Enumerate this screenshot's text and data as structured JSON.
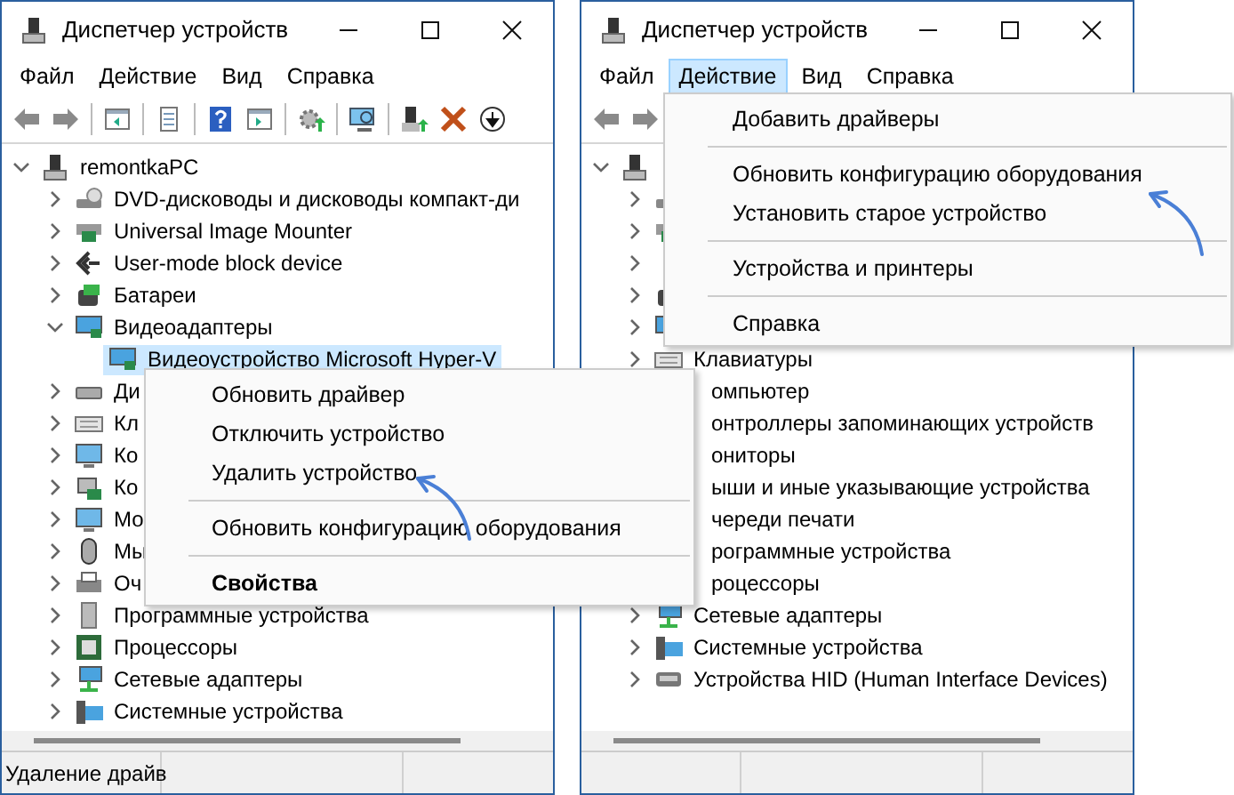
{
  "windows": [
    {
      "title": "Диспетчер устройств",
      "menu": [
        {
          "label": "Файл",
          "selected": false
        },
        {
          "label": "Действие",
          "selected": false
        },
        {
          "label": "Вид",
          "selected": false
        },
        {
          "label": "Справка",
          "selected": false
        }
      ],
      "toolbar": [
        {
          "kind": "back"
        },
        {
          "kind": "forward"
        },
        {
          "kind": "separator"
        },
        {
          "kind": "properties"
        },
        {
          "kind": "separator"
        },
        {
          "kind": "document"
        },
        {
          "kind": "separator"
        },
        {
          "kind": "help"
        },
        {
          "kind": "panel"
        },
        {
          "kind": "separator"
        },
        {
          "kind": "update"
        },
        {
          "kind": "separator"
        },
        {
          "kind": "scan"
        },
        {
          "kind": "separator"
        },
        {
          "kind": "add"
        },
        {
          "kind": "remove"
        },
        {
          "kind": "download"
        }
      ],
      "tree": {
        "kind": "pc",
        "label": "remontkaPC",
        "expanded": true,
        "selected": false,
        "children": [
          {
            "kind": "dvd",
            "label": "DVD-дисководы и дисководы компакт-ди",
            "expanded": false,
            "selected": false
          },
          {
            "kind": "usb",
            "label": "Universal Image Mounter",
            "expanded": false,
            "selected": false
          },
          {
            "kind": "block",
            "label": "User-mode block device",
            "expanded": false,
            "selected": false
          },
          {
            "kind": "battery",
            "label": "Батареи",
            "expanded": false,
            "selected": false
          },
          {
            "kind": "display",
            "label": "Видеоадаптеры",
            "expanded": true,
            "selected": false,
            "children": [
              {
                "kind": "display",
                "label": "Видеоустройство Microsoft Hyper-V",
                "selected": true
              }
            ]
          },
          {
            "kind": "disk",
            "label": "Ди",
            "expanded": false,
            "selected": false
          },
          {
            "kind": "keyboard",
            "label": "Кл",
            "expanded": false,
            "selected": false
          },
          {
            "kind": "computer",
            "label": "Ко",
            "expanded": false,
            "selected": false
          },
          {
            "kind": "storage",
            "label": "Ко",
            "expanded": false,
            "selected": false
          },
          {
            "kind": "computer",
            "label": "Мо",
            "expanded": false,
            "selected": false
          },
          {
            "kind": "mouse",
            "label": "Мы",
            "expanded": false,
            "selected": false
          },
          {
            "kind": "printer",
            "label": "Оч",
            "expanded": false,
            "selected": false
          },
          {
            "kind": "software",
            "label": "Программные устройства",
            "expanded": false,
            "selected": false
          },
          {
            "kind": "cpu",
            "label": "Процессоры",
            "expanded": false,
            "selected": false
          },
          {
            "kind": "network",
            "label": "Сетевые адаптеры",
            "expanded": false,
            "selected": false
          },
          {
            "kind": "system",
            "label": "Системные устройства",
            "expanded": false,
            "selected": false
          }
        ]
      },
      "status_bar": {
        "text": "Удаление драйв"
      },
      "context_menu": {
        "items": [
          {
            "kind": "item",
            "label": "Обновить драйвер",
            "default": false
          },
          {
            "kind": "item",
            "label": "Отключить устройство",
            "default": false
          },
          {
            "kind": "item",
            "label": "Удалить устройство",
            "default": false
          },
          {
            "kind": "separator"
          },
          {
            "kind": "item",
            "label": "Обновить конфигурацию оборудования",
            "default": false
          },
          {
            "kind": "separator"
          },
          {
            "kind": "item",
            "label": "Свойства",
            "default": true
          }
        ]
      }
    },
    {
      "title": "Диспетчер устройств",
      "menu": [
        {
          "label": "Файл",
          "selected": false
        },
        {
          "label": "Действие",
          "selected": true
        },
        {
          "label": "Вид",
          "selected": false
        },
        {
          "label": "Справка",
          "selected": false
        }
      ],
      "toolbar": [
        {
          "kind": "back"
        },
        {
          "kind": "forward"
        }
      ],
      "tree": {
        "kind": "pc",
        "expanded": true,
        "children": [
          {
            "kind": "dvd",
            "expanded": false
          },
          {
            "kind": "usb",
            "expanded": false
          },
          {
            "expanded": false
          },
          {
            "kind": "battery",
            "expanded": false
          },
          {
            "kind": "display",
            "expanded": false
          },
          {
            "kind": "keyboard",
            "label": "Клавиатуры",
            "expanded": false,
            "selected": false
          },
          {
            "label": "омпьютер",
            "clipped": true,
            "selected": false
          },
          {
            "label": "онтроллеры запоминающих устройств",
            "clipped": true,
            "selected": false
          },
          {
            "label": "ониторы",
            "clipped": true,
            "selected": false
          },
          {
            "label": "ыши и иные указывающие устройства",
            "clipped": true,
            "selected": false
          },
          {
            "label": "череди печати",
            "clipped": true,
            "selected": false
          },
          {
            "label": "рограммные устройства",
            "clipped": true,
            "selected": false
          },
          {
            "label": "роцессоры",
            "clipped": true,
            "selected": false
          },
          {
            "kind": "network",
            "label": "Сетевые адаптеры",
            "expanded": false,
            "selected": false
          },
          {
            "kind": "system",
            "label": "Системные устройства",
            "expanded": false,
            "selected": false
          },
          {
            "kind": "hid",
            "label": "Устройства HID (Human Interface Devices)",
            "expanded": false,
            "selected": false
          }
        ]
      },
      "dropdown_menu": {
        "items": [
          {
            "kind": "item",
            "label": "Добавить драйверы"
          },
          {
            "kind": "separator"
          },
          {
            "kind": "item",
            "label": "Обновить конфигурацию оборудования"
          },
          {
            "kind": "item",
            "label": "Установить старое устройство"
          },
          {
            "kind": "separator"
          },
          {
            "kind": "item",
            "label": "Устройства и принтеры"
          },
          {
            "kind": "separator"
          },
          {
            "kind": "item",
            "label": "Справка"
          }
        ]
      }
    }
  ]
}
